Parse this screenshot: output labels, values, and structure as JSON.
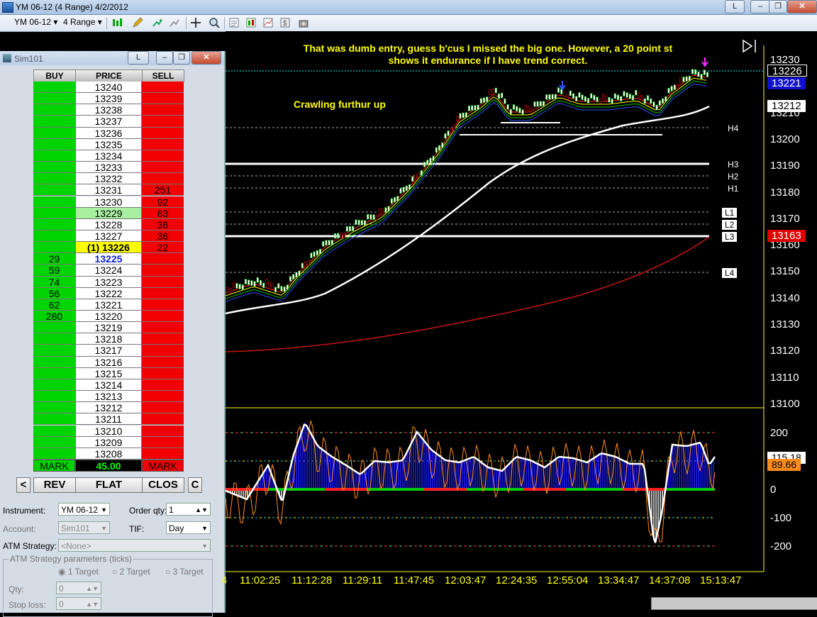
{
  "window": {
    "title": "YM 06-12 (4 Range)  4/2/2012",
    "min_label": "L"
  },
  "toolbar": {
    "instrument": "YM 06-12",
    "period": "4 Range"
  },
  "dom": {
    "title": "Sim101",
    "title_button": "L",
    "headers": {
      "buy": "BUY",
      "price": "PRICE",
      "sell": "SELL"
    },
    "rows": [
      {
        "buy": "",
        "price": "13240",
        "sell": ""
      },
      {
        "buy": "",
        "price": "13239",
        "sell": ""
      },
      {
        "buy": "",
        "price": "13238",
        "sell": ""
      },
      {
        "buy": "",
        "price": "13237",
        "sell": ""
      },
      {
        "buy": "",
        "price": "13236",
        "sell": ""
      },
      {
        "buy": "",
        "price": "13235",
        "sell": ""
      },
      {
        "buy": "",
        "price": "13234",
        "sell": ""
      },
      {
        "buy": "",
        "price": "13233",
        "sell": ""
      },
      {
        "buy": "",
        "price": "13232",
        "sell": ""
      },
      {
        "buy": "",
        "price": "13231",
        "sell": "251"
      },
      {
        "buy": "",
        "price": "13230",
        "sell": "92"
      },
      {
        "buy": "",
        "price": "13229",
        "sell": "63"
      },
      {
        "buy": "",
        "price": "13228",
        "sell": "36"
      },
      {
        "buy": "",
        "price": "13227",
        "sell": "36"
      },
      {
        "buy": "",
        "price": "(1) 13226",
        "sell": "22"
      },
      {
        "buy": "29",
        "price": "13225",
        "sell": ""
      },
      {
        "buy": "59",
        "price": "13224",
        "sell": ""
      },
      {
        "buy": "74",
        "price": "13223",
        "sell": ""
      },
      {
        "buy": "56",
        "price": "13222",
        "sell": ""
      },
      {
        "buy": "62",
        "price": "13221",
        "sell": ""
      },
      {
        "buy": "280",
        "price": "13220",
        "sell": ""
      },
      {
        "buy": "",
        "price": "13219",
        "sell": ""
      },
      {
        "buy": "",
        "price": "13218",
        "sell": ""
      },
      {
        "buy": "",
        "price": "13217",
        "sell": ""
      },
      {
        "buy": "",
        "price": "13216",
        "sell": ""
      },
      {
        "buy": "",
        "price": "13215",
        "sell": ""
      },
      {
        "buy": "",
        "price": "13214",
        "sell": ""
      },
      {
        "buy": "",
        "price": "13213",
        "sell": ""
      },
      {
        "buy": "",
        "price": "13212",
        "sell": ""
      },
      {
        "buy": "",
        "price": "13211",
        "sell": ""
      },
      {
        "buy": "",
        "price": "13210",
        "sell": ""
      },
      {
        "buy": "",
        "price": "13209",
        "sell": ""
      },
      {
        "buy": "",
        "price": "13208",
        "sell": ""
      }
    ],
    "footer": {
      "buy": "MARK",
      "price": "45.00",
      "sell": "MARK"
    },
    "buttons": {
      "left": "<",
      "rev": "REV",
      "flat": "FLAT",
      "clos": "CLOS",
      "c": "C"
    },
    "form": {
      "instrument_label": "Instrument:",
      "instrument_value": "YM 06-12",
      "order_qty_label": "Order qty:",
      "order_qty_value": "1",
      "account_label": "Account:",
      "account_value": "Sim101",
      "tif_label": "TIF:",
      "tif_value": "Day",
      "atm_label": "ATM Strategy:",
      "atm_value": "<None>",
      "atm_params_label": "ATM Strategy parameters (ticks)",
      "target1": "1 Target",
      "target2": "2 Target",
      "target3": "3 Target",
      "qty_label": "Qty:",
      "qty_value": "0",
      "stop_label": "Stop loss:",
      "stop_value": "0"
    }
  },
  "chart": {
    "annotation_top_line1": "That was dumb entry, guess b'cus I missed the big one. However, a 20 point st",
    "annotation_top_line2": "shows it endurance if I have trend correct.",
    "annotation_left": "Crawling furthur up",
    "price_axis": [
      "13230",
      "13220",
      "13210",
      "13200",
      "13190",
      "13180",
      "13170",
      "13160",
      "13150",
      "13140",
      "13130",
      "13120",
      "13110",
      "13100"
    ],
    "osc_axis": [
      "200",
      "100",
      "0",
      "-100",
      "-200"
    ],
    "time_axis": [
      "4",
      "11:02:25",
      "11:12:28",
      "11:29:11",
      "11:47:45",
      "12:03:47",
      "12:24:35",
      "12:55:04",
      "13:34:47",
      "14:37:08",
      "15:13:47"
    ],
    "level_labels": {
      "h4": "H4",
      "h3": "H3",
      "h2": "H2",
      "h1": "H1",
      "l1": "L1",
      "l2": "L2",
      "l3": "L3",
      "l4": "L4"
    },
    "price_boxes": {
      "last": "13226",
      "bid": "13221",
      "ma": "13212",
      "sma": "13163",
      "osc1": "115.18",
      "osc2": "89.66"
    },
    "colors": {
      "ask_line": "#00c8c8",
      "ma_white": "#ffffff",
      "ma_red": "#c81414",
      "osc_fill": "#1414c8"
    }
  }
}
